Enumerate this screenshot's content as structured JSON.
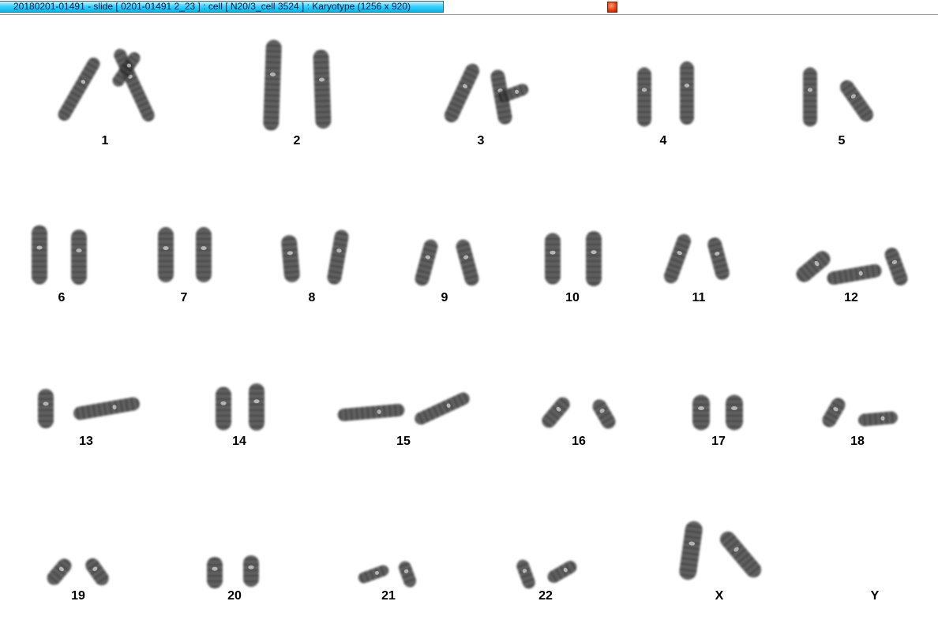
{
  "window": {
    "title": "20180201-01491 - slide [ 0201-01491 2_23 ] : cell [ N20/3_cell 3524 ] : Karyotype  (1256 x 920)"
  },
  "karyotype": {
    "labels": [
      "1",
      "2",
      "3",
      "4",
      "5",
      "6",
      "7",
      "8",
      "9",
      "10",
      "11",
      "12",
      "13",
      "14",
      "15",
      "16",
      "17",
      "18",
      "19",
      "20",
      "21",
      "22",
      "X",
      "Y"
    ]
  },
  "icons": {
    "close": "close-icon"
  },
  "colors": {
    "title_gradient_mid": "#33d6ff",
    "close_button": "#e0340c",
    "chromosome": "#2a2a2a"
  }
}
